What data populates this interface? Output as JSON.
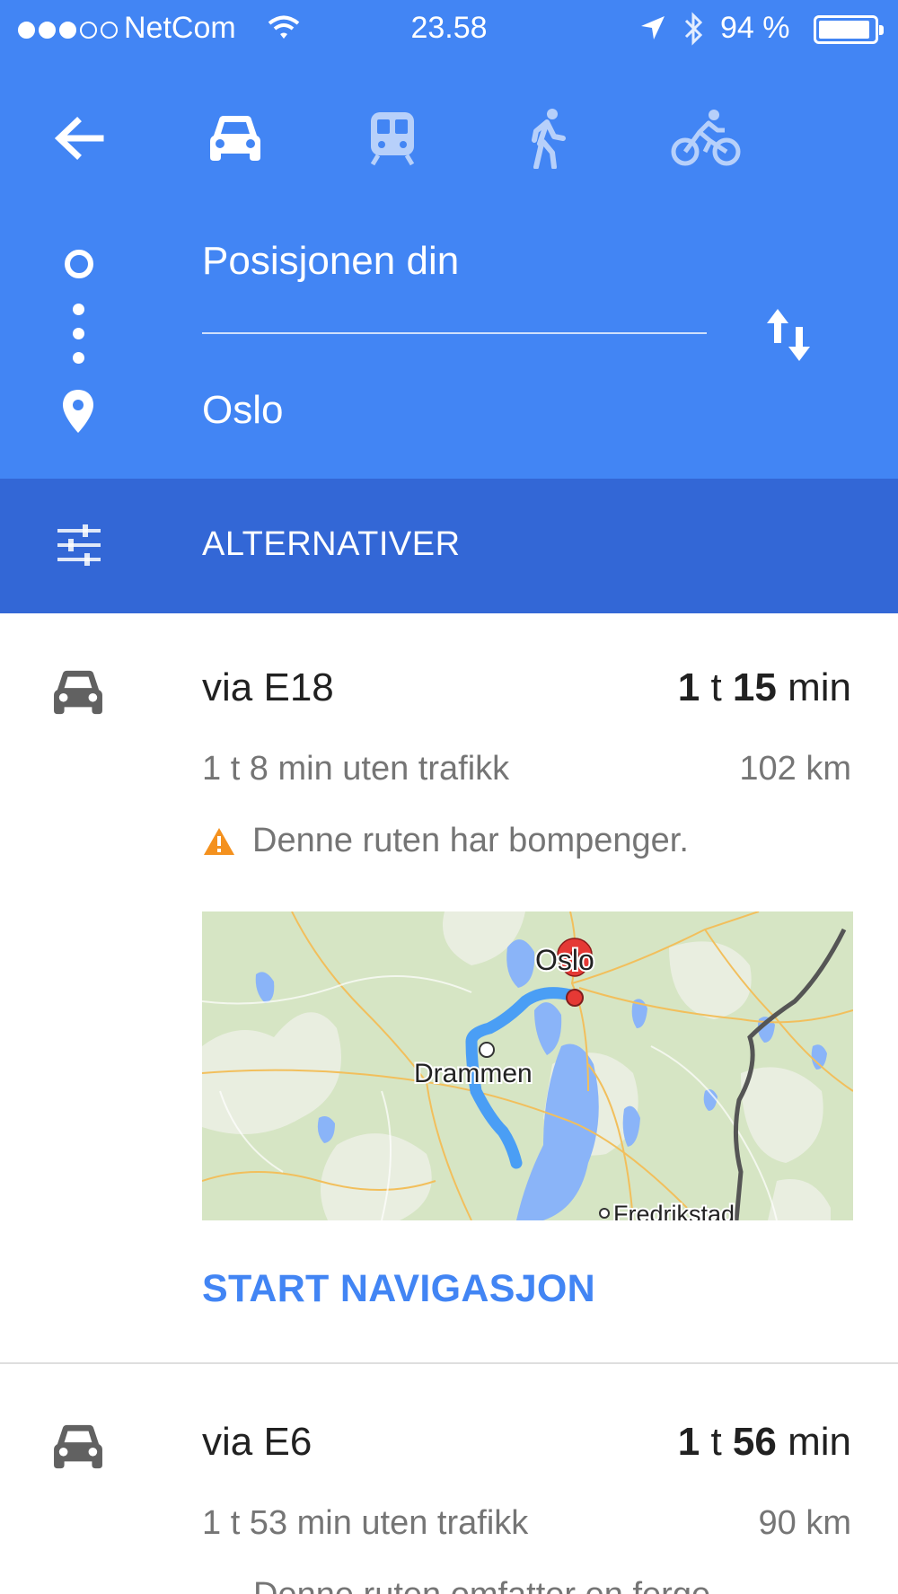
{
  "status_bar": {
    "carrier": "NetCom",
    "time": "23.58",
    "battery_percent": "94 %",
    "battery_level": 0.94
  },
  "header": {
    "origin": "Posisjonen din",
    "destination": "Oslo",
    "active_mode": "car",
    "options_label": "ALTERNATIVER"
  },
  "routes": [
    {
      "name": "via E18",
      "duration_hours": "1",
      "duration_hours_unit": "t",
      "duration_minutes": "15",
      "duration_minutes_unit": "min",
      "no_traffic": "1 t 8 min uten trafikk",
      "distance": "102 km",
      "warning": "Denne ruten har bompenger.",
      "map_labels": {
        "city_1": "Oslo",
        "city_2": "Drammen",
        "city_3": "Fredrikstad"
      },
      "action": "START NAVIGASJON"
    },
    {
      "name": "via E6",
      "duration_hours": "1",
      "duration_hours_unit": "t",
      "duration_minutes": "56",
      "duration_minutes_unit": "min",
      "no_traffic": "1 t 53 min uten trafikk",
      "distance": "90 km",
      "warning": "Denne ruten omfatter en ferge."
    }
  ],
  "colors": {
    "header": "#4285f4",
    "options_bar": "#3367d6",
    "accent": "#4285f4",
    "warning": "#f4911e",
    "route_line": "#4a9ef5",
    "pin": "#e53935"
  }
}
